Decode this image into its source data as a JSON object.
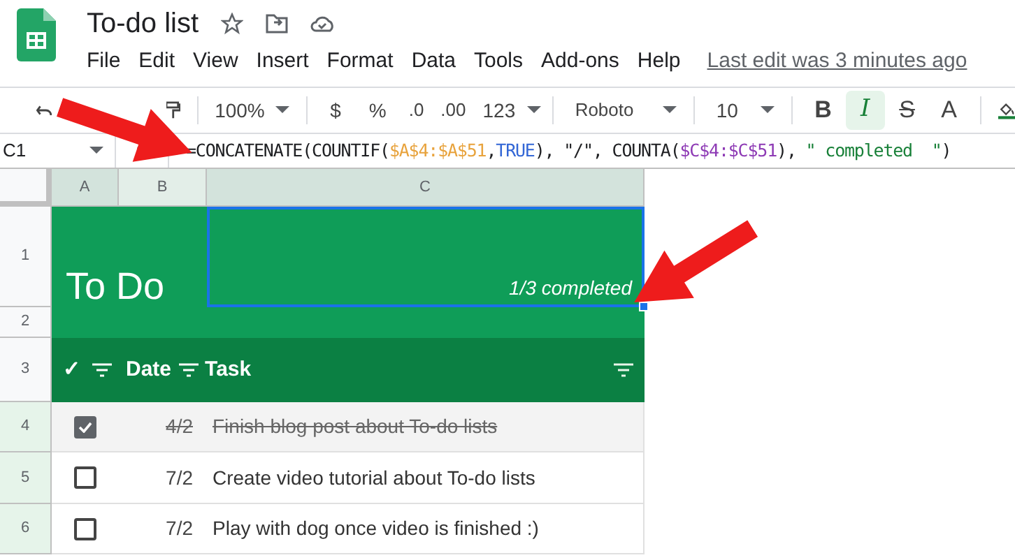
{
  "document": {
    "title": "To-do list",
    "last_edit": "Last edit was 3 minutes ago"
  },
  "menu": [
    "File",
    "Edit",
    "View",
    "Insert",
    "Format",
    "Data",
    "Tools",
    "Add-ons",
    "Help"
  ],
  "toolbar": {
    "zoom": "100%",
    "currency": "$",
    "percent": "%",
    "decimal_less": ".0",
    "decimal_more": ".00",
    "number_format": "123",
    "font": "Roboto",
    "font_size": "10",
    "styles": [
      {
        "label": "B",
        "kind": "bold",
        "selected": false
      },
      {
        "label": "I",
        "kind": "italic",
        "selected": true
      },
      {
        "label": "S",
        "kind": "strike",
        "selected": false
      },
      {
        "label": "A",
        "kind": "color",
        "selected": false
      }
    ]
  },
  "formula_bar": {
    "cell": "C1",
    "tokens": [
      {
        "text": "=CONCATENATE(COUNTIF(",
        "color": "#202124"
      },
      {
        "text": "$A$4:$A$51",
        "color": "#e8a33d"
      },
      {
        "text": ",",
        "color": "#202124"
      },
      {
        "text": "TRUE",
        "color": "#3367d6"
      },
      {
        "text": "), \"/\", COUNTA(",
        "color": "#202124"
      },
      {
        "text": "$C$4:$C$51",
        "color": "#8e3bb5"
      },
      {
        "text": "), ",
        "color": "#202124"
      },
      {
        "text": "\" completed  \"",
        "color": "#188038"
      },
      {
        "text": ")",
        "color": "#202124"
      }
    ]
  },
  "columns": [
    "A",
    "B",
    "C"
  ],
  "row_numbers": [
    "1",
    "2",
    "3",
    "4",
    "5",
    "6"
  ],
  "sheet": {
    "heading": "To Do",
    "summary": "1/3 completed",
    "header": {
      "check": "✓",
      "date": "Date",
      "task": "Task"
    },
    "tasks": [
      {
        "checked": true,
        "date": "4/2",
        "task": "Finish blog post about To-do lists"
      },
      {
        "checked": false,
        "date": "7/2",
        "task": "Create video tutorial about To-do lists"
      },
      {
        "checked": false,
        "date": "7/2",
        "task": "Play with dog once video is finished :)"
      }
    ]
  }
}
